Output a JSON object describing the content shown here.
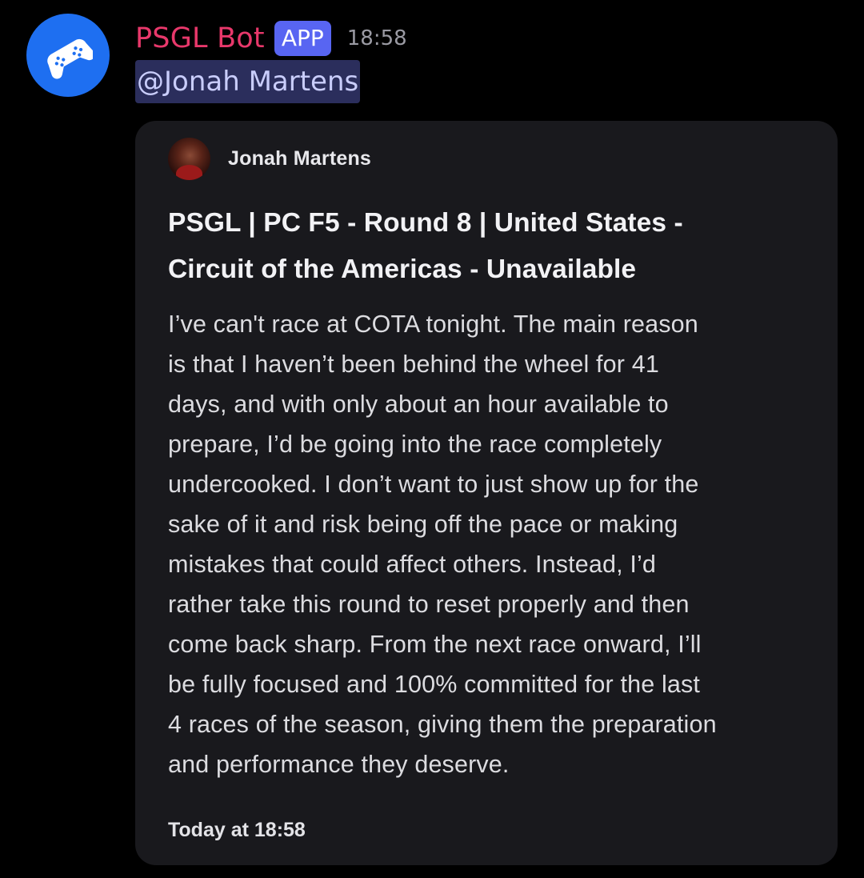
{
  "message": {
    "bot_name": "PSGL Bot",
    "badge": "APP",
    "timestamp": "18:58",
    "mention": "@Jonah Martens",
    "avatar_icon": "gamepad-icon",
    "avatar_color": "#1e6ff1",
    "name_color": "#e8386b",
    "badge_color": "#5865f2"
  },
  "embed": {
    "author_name": "Jonah Martens",
    "title_line1": "PSGL | PC F5 - Round 8 | United States -",
    "title_line2": "Circuit of the Americas - Unavailable",
    "description_lines": [
      "I’ve can't race at COTA tonight. The main reason",
      "is that I haven’t been behind the wheel for 41",
      "days, and with only about an hour available to",
      "prepare, I’d be going into the race completely",
      "undercooked. I don’t want to just show up for the",
      "sake of it and risk being off the pace or making",
      "mistakes that could affect others. Instead, I’d",
      "rather take this round to reset properly and then",
      "come back sharp. From the next race onward, I’ll",
      "be fully focused and 100% committed for the last",
      "4 races of the season, giving them the preparation",
      "and performance they deserve."
    ],
    "footer": "Today at 18:58",
    "background_color": "#19191d"
  }
}
